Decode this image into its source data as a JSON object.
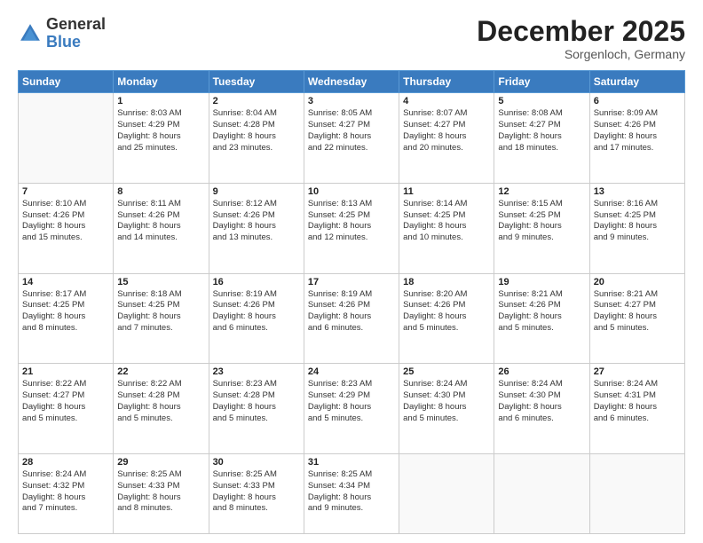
{
  "header": {
    "logo_general": "General",
    "logo_blue": "Blue",
    "month_title": "December 2025",
    "location": "Sorgenloch, Germany"
  },
  "days_of_week": [
    "Sunday",
    "Monday",
    "Tuesday",
    "Wednesday",
    "Thursday",
    "Friday",
    "Saturday"
  ],
  "weeks": [
    [
      {
        "day": "",
        "info": ""
      },
      {
        "day": "1",
        "info": "Sunrise: 8:03 AM\nSunset: 4:29 PM\nDaylight: 8 hours\nand 25 minutes."
      },
      {
        "day": "2",
        "info": "Sunrise: 8:04 AM\nSunset: 4:28 PM\nDaylight: 8 hours\nand 23 minutes."
      },
      {
        "day": "3",
        "info": "Sunrise: 8:05 AM\nSunset: 4:27 PM\nDaylight: 8 hours\nand 22 minutes."
      },
      {
        "day": "4",
        "info": "Sunrise: 8:07 AM\nSunset: 4:27 PM\nDaylight: 8 hours\nand 20 minutes."
      },
      {
        "day": "5",
        "info": "Sunrise: 8:08 AM\nSunset: 4:27 PM\nDaylight: 8 hours\nand 18 minutes."
      },
      {
        "day": "6",
        "info": "Sunrise: 8:09 AM\nSunset: 4:26 PM\nDaylight: 8 hours\nand 17 minutes."
      }
    ],
    [
      {
        "day": "7",
        "info": "Sunrise: 8:10 AM\nSunset: 4:26 PM\nDaylight: 8 hours\nand 15 minutes."
      },
      {
        "day": "8",
        "info": "Sunrise: 8:11 AM\nSunset: 4:26 PM\nDaylight: 8 hours\nand 14 minutes."
      },
      {
        "day": "9",
        "info": "Sunrise: 8:12 AM\nSunset: 4:26 PM\nDaylight: 8 hours\nand 13 minutes."
      },
      {
        "day": "10",
        "info": "Sunrise: 8:13 AM\nSunset: 4:25 PM\nDaylight: 8 hours\nand 12 minutes."
      },
      {
        "day": "11",
        "info": "Sunrise: 8:14 AM\nSunset: 4:25 PM\nDaylight: 8 hours\nand 10 minutes."
      },
      {
        "day": "12",
        "info": "Sunrise: 8:15 AM\nSunset: 4:25 PM\nDaylight: 8 hours\nand 9 minutes."
      },
      {
        "day": "13",
        "info": "Sunrise: 8:16 AM\nSunset: 4:25 PM\nDaylight: 8 hours\nand 9 minutes."
      }
    ],
    [
      {
        "day": "14",
        "info": "Sunrise: 8:17 AM\nSunset: 4:25 PM\nDaylight: 8 hours\nand 8 minutes."
      },
      {
        "day": "15",
        "info": "Sunrise: 8:18 AM\nSunset: 4:25 PM\nDaylight: 8 hours\nand 7 minutes."
      },
      {
        "day": "16",
        "info": "Sunrise: 8:19 AM\nSunset: 4:26 PM\nDaylight: 8 hours\nand 6 minutes."
      },
      {
        "day": "17",
        "info": "Sunrise: 8:19 AM\nSunset: 4:26 PM\nDaylight: 8 hours\nand 6 minutes."
      },
      {
        "day": "18",
        "info": "Sunrise: 8:20 AM\nSunset: 4:26 PM\nDaylight: 8 hours\nand 5 minutes."
      },
      {
        "day": "19",
        "info": "Sunrise: 8:21 AM\nSunset: 4:26 PM\nDaylight: 8 hours\nand 5 minutes."
      },
      {
        "day": "20",
        "info": "Sunrise: 8:21 AM\nSunset: 4:27 PM\nDaylight: 8 hours\nand 5 minutes."
      }
    ],
    [
      {
        "day": "21",
        "info": "Sunrise: 8:22 AM\nSunset: 4:27 PM\nDaylight: 8 hours\nand 5 minutes."
      },
      {
        "day": "22",
        "info": "Sunrise: 8:22 AM\nSunset: 4:28 PM\nDaylight: 8 hours\nand 5 minutes."
      },
      {
        "day": "23",
        "info": "Sunrise: 8:23 AM\nSunset: 4:28 PM\nDaylight: 8 hours\nand 5 minutes."
      },
      {
        "day": "24",
        "info": "Sunrise: 8:23 AM\nSunset: 4:29 PM\nDaylight: 8 hours\nand 5 minutes."
      },
      {
        "day": "25",
        "info": "Sunrise: 8:24 AM\nSunset: 4:30 PM\nDaylight: 8 hours\nand 5 minutes."
      },
      {
        "day": "26",
        "info": "Sunrise: 8:24 AM\nSunset: 4:30 PM\nDaylight: 8 hours\nand 6 minutes."
      },
      {
        "day": "27",
        "info": "Sunrise: 8:24 AM\nSunset: 4:31 PM\nDaylight: 8 hours\nand 6 minutes."
      }
    ],
    [
      {
        "day": "28",
        "info": "Sunrise: 8:24 AM\nSunset: 4:32 PM\nDaylight: 8 hours\nand 7 minutes."
      },
      {
        "day": "29",
        "info": "Sunrise: 8:25 AM\nSunset: 4:33 PM\nDaylight: 8 hours\nand 8 minutes."
      },
      {
        "day": "30",
        "info": "Sunrise: 8:25 AM\nSunset: 4:33 PM\nDaylight: 8 hours\nand 8 minutes."
      },
      {
        "day": "31",
        "info": "Sunrise: 8:25 AM\nSunset: 4:34 PM\nDaylight: 8 hours\nand 9 minutes."
      },
      {
        "day": "",
        "info": ""
      },
      {
        "day": "",
        "info": ""
      },
      {
        "day": "",
        "info": ""
      }
    ]
  ]
}
